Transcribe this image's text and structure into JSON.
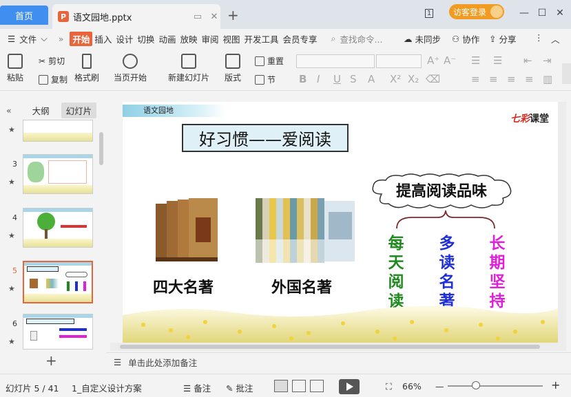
{
  "titlebar": {
    "home_tab": "首页",
    "file_tab": "语文园地.pptx",
    "file_badge": "P",
    "visitor_login": "访客登录",
    "page_indicator": "1"
  },
  "menubar": {
    "file_menu": "文件",
    "items": [
      "开始",
      "插入",
      "设计",
      "切换",
      "动画",
      "放映",
      "审阅",
      "视图",
      "开发工具",
      "会员专享"
    ],
    "search_placeholder": "查找命令...",
    "unsynced": "未同步",
    "collaborate": "协作",
    "share": "分享"
  },
  "ribbon": {
    "paste": "粘贴",
    "cut": "剪切",
    "copy": "复制",
    "format_painter": "格式刷",
    "play_from_current": "当页开始",
    "new_slide": "新建幻灯片",
    "layout": "版式",
    "reset": "重置",
    "section": "节"
  },
  "left_panel": {
    "tab_outline": "大纲",
    "tab_slides": "幻灯片",
    "thumbnails": [
      {
        "num": "",
        "star": "★"
      },
      {
        "num": "3",
        "star": "★"
      },
      {
        "num": "4",
        "star": "★"
      },
      {
        "num": "5",
        "star": "★",
        "active": true
      },
      {
        "num": "6",
        "star": "★"
      }
    ],
    "add_slide": "+"
  },
  "slide": {
    "tag": "语文园地",
    "logo_red": "七彩",
    "logo_black": "课堂",
    "title": "好习惯——爱阅读",
    "caption_left": "四大名著",
    "caption_middle": "外国名著",
    "cloud_text": "提高阅读品味",
    "columns": [
      {
        "text": [
          "每",
          "天",
          "阅",
          "读"
        ],
        "color": "#1f8a1f"
      },
      {
        "text": [
          "多",
          "读",
          "名",
          "著"
        ],
        "color": "#1f2fd6"
      },
      {
        "text": [
          "长",
          "期",
          "坚",
          "持"
        ],
        "color": "#e020d6"
      }
    ]
  },
  "notes": {
    "placeholder": "单击此处添加备注"
  },
  "status": {
    "slide_counter": "幻灯片 5 / 41",
    "theme": "1_自定义设计方案",
    "notes_btn": "备注",
    "comments_btn": "批注",
    "zoom": "66%",
    "zoom_fraction": 0.3
  }
}
